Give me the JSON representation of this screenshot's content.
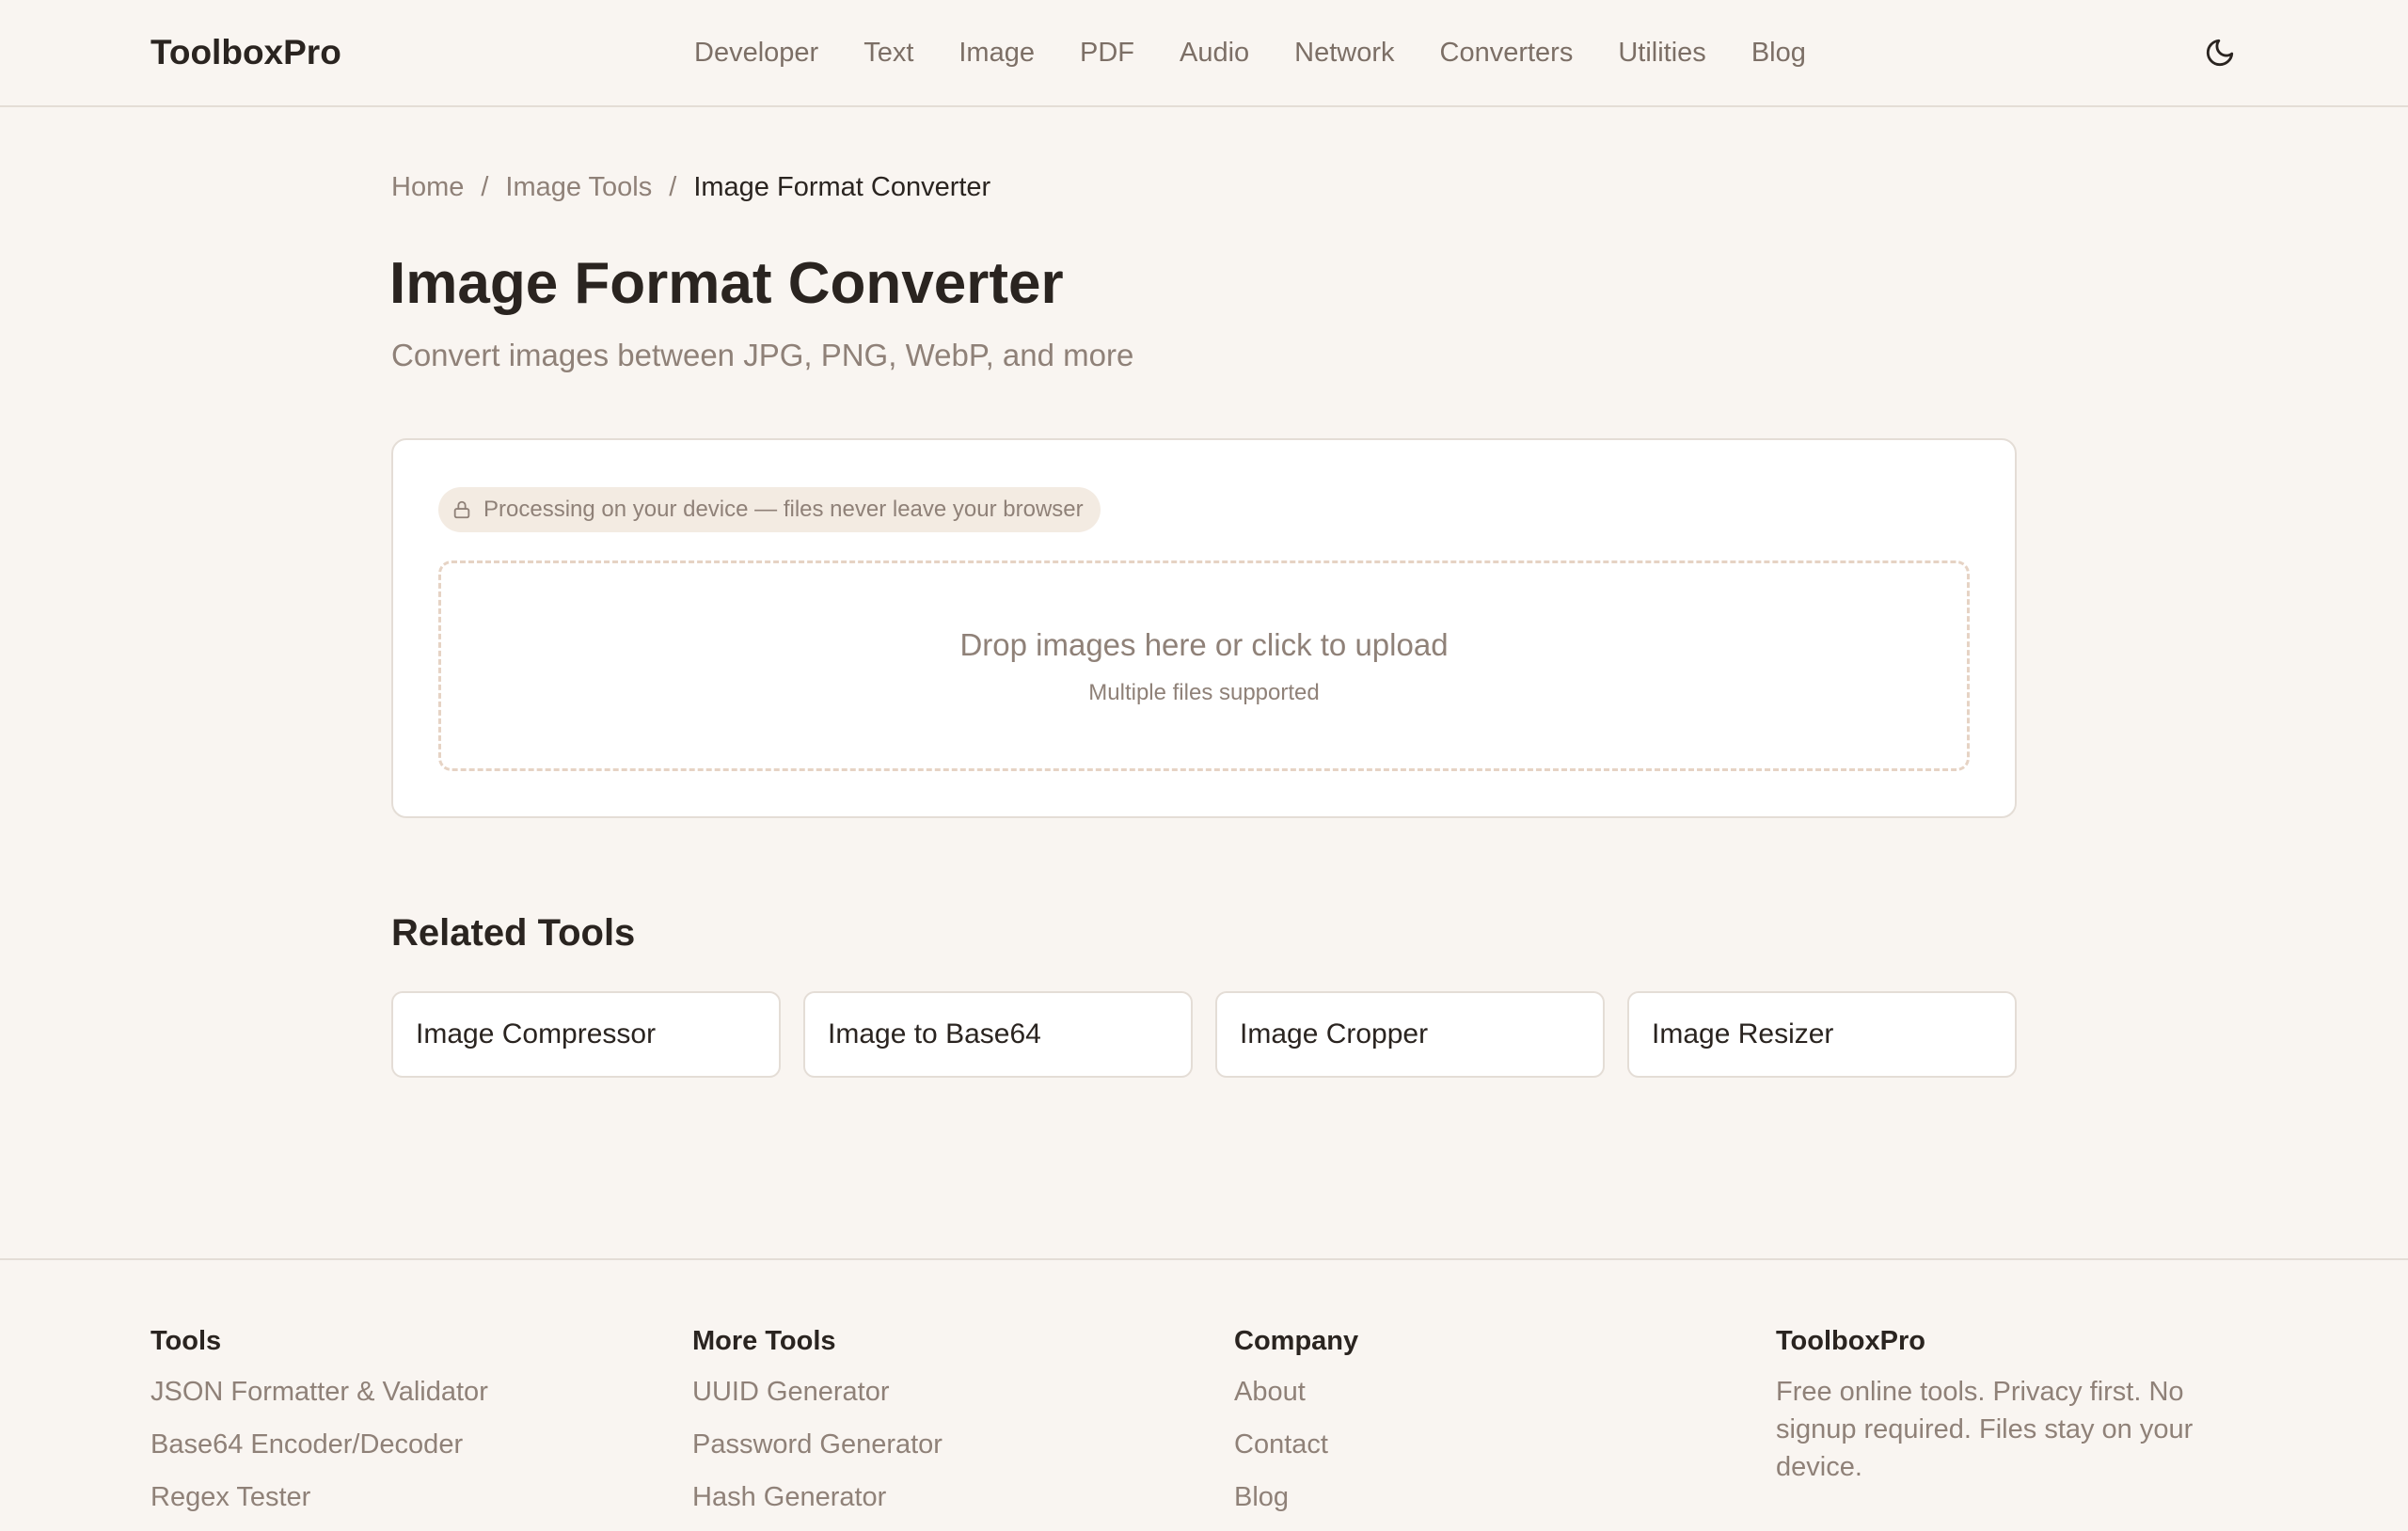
{
  "header": {
    "logo": "ToolboxPro",
    "nav": [
      "Developer",
      "Text",
      "Image",
      "PDF",
      "Audio",
      "Network",
      "Converters",
      "Utilities",
      "Blog"
    ],
    "theme_toggle_icon": "moon-icon"
  },
  "breadcrumb": {
    "home": "Home",
    "section": "Image Tools",
    "current": "Image Format Converter",
    "separator": "/"
  },
  "page": {
    "title": "Image Format Converter",
    "subtitle": "Convert images between JPG, PNG, WebP, and more"
  },
  "tool": {
    "privacy_badge": "Processing on your device — files never leave your browser",
    "privacy_icon": "lock-icon",
    "dropzone_title": "Drop images here or click to upload",
    "dropzone_subtitle": "Multiple files supported"
  },
  "related": {
    "title": "Related Tools",
    "items": [
      "Image Compressor",
      "Image to Base64",
      "Image Cropper",
      "Image Resizer"
    ]
  },
  "footer": {
    "tools": {
      "heading": "Tools",
      "links": [
        "JSON Formatter & Validator",
        "Base64 Encoder/Decoder",
        "Regex Tester"
      ]
    },
    "more_tools": {
      "heading": "More Tools",
      "links": [
        "UUID Generator",
        "Password Generator",
        "Hash Generator"
      ]
    },
    "company": {
      "heading": "Company",
      "links": [
        "About",
        "Contact",
        "Blog"
      ]
    },
    "brand": {
      "heading": "ToolboxPro",
      "text": "Free online tools. Privacy first. No signup required. Files stay on your device."
    }
  },
  "colors": {
    "background": "#f9f5f1",
    "text": "#2a2420",
    "muted": "#8f8178",
    "border": "#e4ddd6",
    "badge_bg": "#f3ebe2",
    "dashed_border": "#e6d3c4"
  }
}
